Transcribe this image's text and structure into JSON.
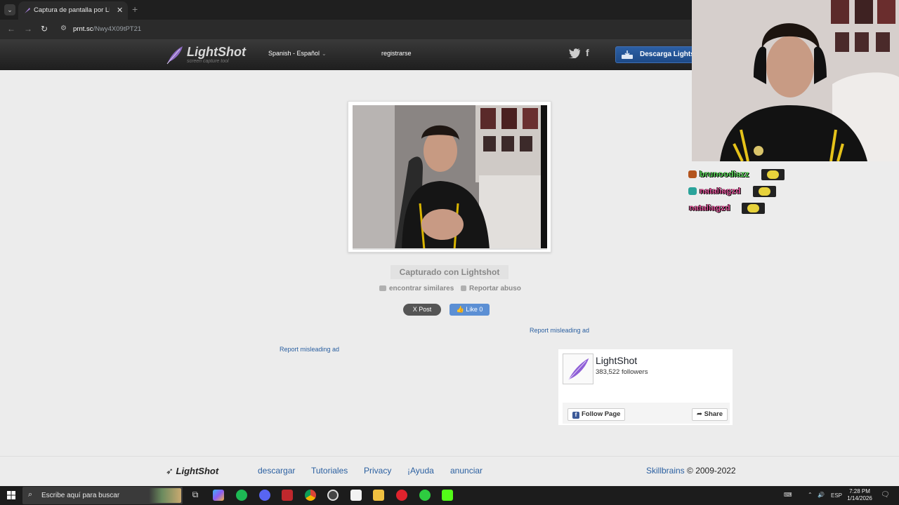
{
  "browser": {
    "tab_title": "Captura de pantalla por Lightsh",
    "url_host": "prnt.sc",
    "url_path": "/Nwy4X09tPT21"
  },
  "header": {
    "logo_name": "LightShot",
    "logo_tagline": "screen capture tool",
    "language": "Spanish - Español",
    "register": "registrarse",
    "download_button": "Descarga Lights"
  },
  "main": {
    "captured_label": "Capturado con Lightshot",
    "find_similar": "encontrar similares",
    "report_abuse": "Reportar abuso",
    "post_button": "X Post",
    "like_button": "Like 0",
    "report_ad_1": "Report misleading ad",
    "report_ad_2": "Report misleading ad"
  },
  "facebook_card": {
    "page_name": "LightShot",
    "followers": "383,522 followers",
    "follow_button": "Follow Page",
    "share_button": "Share"
  },
  "footer": {
    "logo": "LightShot",
    "links": [
      "descargar",
      "Tutoriales",
      "Privacy",
      "¡Ayuda",
      "anunciar"
    ],
    "copyright_brand": "Skillbrains",
    "copyright_years": "© 2009-2022"
  },
  "taskbar": {
    "search_placeholder": "Escribe aquí para buscar",
    "language": "ESP",
    "time": "7:28 PM",
    "date": "1/14/2026"
  },
  "chat": [
    {
      "name": "brunoodiazz",
      "color": "#5cd65c"
    },
    {
      "name": "nataliagzd",
      "color": "#e0559a"
    },
    {
      "name": "nataliagzd",
      "color": "#e0559a"
    }
  ],
  "colors": {
    "accent_blue": "#2a5fa0",
    "header_dark": "#1e1e1e",
    "page_bg": "#ececec"
  }
}
